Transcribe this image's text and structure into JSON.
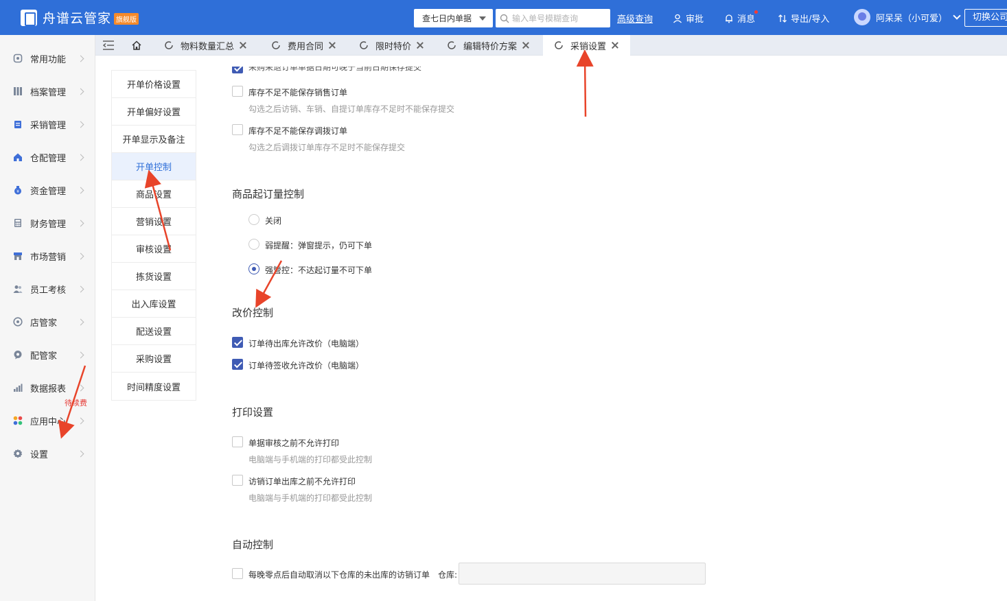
{
  "header": {
    "app_name": "舟谱云管家",
    "edition_badge": "旗舰版",
    "range_select": "查七日内单据",
    "search_placeholder": "输入单号模糊查询",
    "advanced_search": "高级查询",
    "approve": "审批",
    "messages": "消息",
    "import_export": "导出/导入",
    "user_name": "阿呆呆（小可爱）",
    "switch_company": "切换公司"
  },
  "sidebar": {
    "items": [
      {
        "label": "常用功能",
        "icon": "star-icon"
      },
      {
        "label": "档案管理",
        "icon": "grid-icon"
      },
      {
        "label": "采销管理",
        "icon": "clipboard-icon"
      },
      {
        "label": "仓配管理",
        "icon": "home-icon"
      },
      {
        "label": "资金管理",
        "icon": "money-bag-icon"
      },
      {
        "label": "财务管理",
        "icon": "calculator-icon"
      },
      {
        "label": "市场营销",
        "icon": "store-icon"
      },
      {
        "label": "员工考核",
        "icon": "users-icon"
      },
      {
        "label": "店管家",
        "icon": "shop-icon"
      },
      {
        "label": "配管家",
        "icon": "chat-icon"
      },
      {
        "label": "数据报表",
        "icon": "bar-chart-icon"
      },
      {
        "label": "应用中心",
        "icon": "apps-icon",
        "badge": "待续费"
      },
      {
        "label": "设置",
        "icon": "gear-icon"
      }
    ]
  },
  "tabs": [
    {
      "label": "物料数量汇总"
    },
    {
      "label": "费用合同"
    },
    {
      "label": "限时特价"
    },
    {
      "label": "编辑特价方案"
    },
    {
      "label": "采销设置",
      "active": true
    }
  ],
  "settings_nav": [
    "开单价格设置",
    "开单偏好设置",
    "开单显示及备注",
    "开单控制",
    "商品设置",
    "营销设置",
    "审核设置",
    "拣货设置",
    "出入库设置",
    "配送设置",
    "采购设置",
    "时间精度设置"
  ],
  "settings_nav_active": "开单控制",
  "content": {
    "cut_option": "采购采退订单单据日期可晚于当前日期保存提交",
    "stock_sales": {
      "label": "库存不足不能保存销售订单",
      "hint": "勾选之后访销、车销、自提订单库存不足时不能保存提交"
    },
    "stock_transfer": {
      "label": "库存不足不能保存调拨订单",
      "hint": "勾选之后调拨订单库存不足时不能保存提交"
    },
    "moq": {
      "title": "商品起订量控制",
      "options": [
        "关闭",
        "弱提醒：弹窗提示，仍可下单",
        "强管控：不达起订量不可下单"
      ],
      "selected": 2
    },
    "price_change": {
      "title": "改价控制",
      "options": [
        "订单待出库允许改价（电脑端）",
        "订单待签收允许改价（电脑端）"
      ]
    },
    "print": {
      "title": "打印设置",
      "opt1": {
        "label": "单据审核之前不允许打印",
        "hint": "电脑端与手机端的打印都受此控制"
      },
      "opt2": {
        "label": "访销订单出库之前不允许打印",
        "hint": "电脑端与手机端的打印都受此控制"
      }
    },
    "auto": {
      "title": "自动控制",
      "label": "每晚零点后自动取消以下仓库的未出库的访销订单",
      "warehouse_label": "仓库:"
    }
  },
  "colors": {
    "header_bg": "#2f6fd8",
    "accent": "#3f5bb4",
    "annotation_arrow": "#e8442a"
  }
}
